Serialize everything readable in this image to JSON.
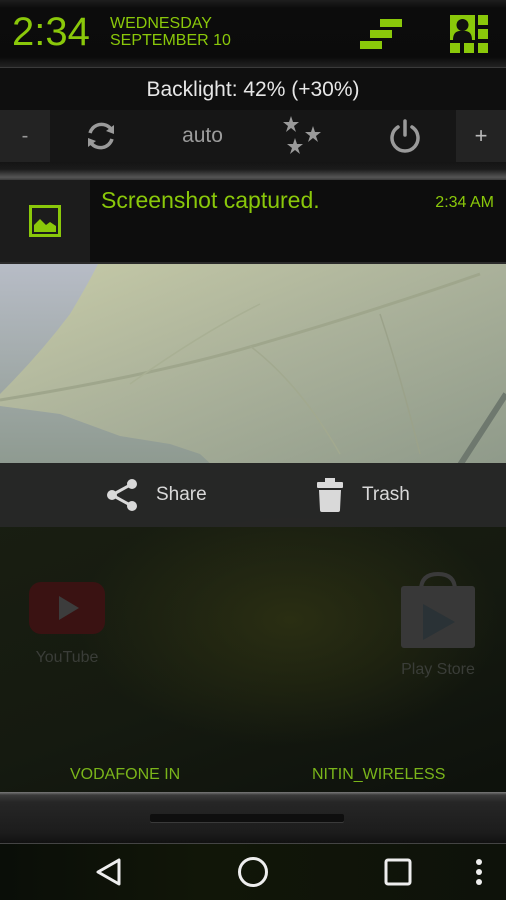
{
  "status": {
    "time": "2:34",
    "weekday": "WEDNESDAY",
    "date": "SEPTEMBER 10",
    "accent_color": "#8ac80a",
    "icons": [
      "settings-icon",
      "profile-grid-icon"
    ]
  },
  "backlight": {
    "text": "Backlight: 42% (+30%)",
    "level_percent": 42,
    "offset_percent": 30,
    "controls": {
      "decrease_label": "-",
      "auto_label": "auto",
      "increase_label": "+",
      "icons": [
        "sync-icon",
        "stars-icon",
        "power-icon"
      ]
    }
  },
  "notification": {
    "title": "Screenshot captured.",
    "time": "2:34 AM",
    "icon": "image-icon",
    "actions": [
      {
        "label": "Share",
        "icon": "share-icon"
      },
      {
        "label": "Trash",
        "icon": "trash-icon"
      }
    ]
  },
  "home_apps": [
    {
      "label": "YouTube",
      "icon": "youtube-icon"
    },
    {
      "label": "Play Store",
      "icon": "play-store-icon"
    }
  ],
  "network": {
    "carrier": "VODAFONE IN",
    "wifi": "NITIN_WIRELESS"
  },
  "navbar": {
    "buttons": [
      "back-icon",
      "home-icon",
      "recents-icon",
      "overflow-menu-icon"
    ]
  }
}
